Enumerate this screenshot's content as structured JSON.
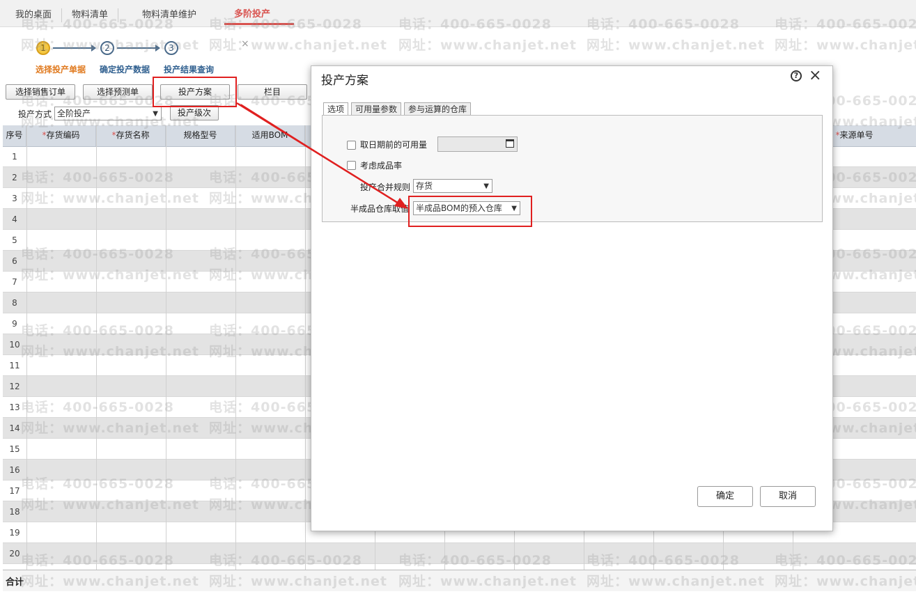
{
  "top_tabs": [
    {
      "label": "我的桌面"
    },
    {
      "label": "物料清单"
    },
    {
      "label": "物料清单维护"
    },
    {
      "label": "多阶投产",
      "close": "×"
    }
  ],
  "steps": [
    {
      "num": "1",
      "label": "选择投产单据"
    },
    {
      "num": "2",
      "label": "确定投产数据"
    },
    {
      "num": "3",
      "label": "投产结果查询"
    }
  ],
  "toolbar": {
    "sales_order_btn": "选择销售订单",
    "forecast_btn": "选择预测单",
    "plan_btn": "投产方案",
    "columns_btn": "栏目",
    "mode_label": "投产方式",
    "mode_value": "全阶投产",
    "level_btn": "投产级次"
  },
  "grid": {
    "headers": {
      "seq": "序号",
      "code": "存货编码",
      "name": "存货名称",
      "spec": "规格型号",
      "bom": "适用BOM",
      "source": "来源单号"
    },
    "rows": [
      "1",
      "2",
      "3",
      "4",
      "5",
      "6",
      "7",
      "8",
      "9",
      "10",
      "11",
      "12",
      "13",
      "14",
      "15",
      "16",
      "17",
      "18",
      "19",
      "20"
    ],
    "total_label": "合计"
  },
  "watermark": {
    "phone": "电话：400-665-0028",
    "site": "网址：www.chanjet.net"
  },
  "dialog": {
    "title": "投产方案",
    "help_icon": "?",
    "close_icon": "×",
    "tabs": [
      "选项",
      "可用量参数",
      "参与运算的仓库"
    ],
    "opt_before_date": "取日期前的可用量",
    "date_value": "",
    "opt_yield": "考虑成品率",
    "merge_label": "投产合并规则",
    "merge_value": "存货",
    "semi_label": "半成品仓库取值",
    "semi_value": "半成品BOM的预入仓库",
    "ok": "确定",
    "cancel": "取消"
  },
  "colors": {
    "accent": "#d9534f",
    "highlight": "#e02020",
    "step_done": "#f5c842",
    "header_bg": "#d6dce4"
  }
}
